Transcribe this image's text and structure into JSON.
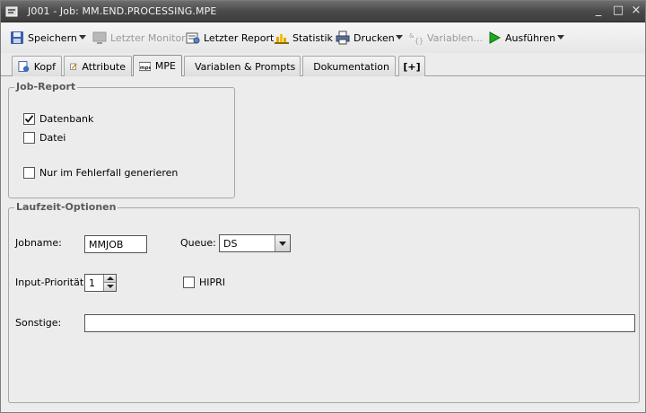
{
  "window": {
    "title": "J001 - Job: MM.END.PROCESSING.MPE",
    "minimize_symbol": "_",
    "maximize_symbol": "□",
    "close_symbol": "×"
  },
  "toolbar": {
    "save_label": "Speichern",
    "last_monitor_label": "Letzter Monitor",
    "last_report_label": "Letzter Report",
    "statistics_label": "Statistik",
    "print_label": "Drucken",
    "variables_label": "Variablen...",
    "execute_label": "Ausführen"
  },
  "tabs": [
    {
      "label": "Kopf",
      "icon": "header-icon"
    },
    {
      "label": "Attribute",
      "icon": "attributes-icon"
    },
    {
      "label": "MPE",
      "icon": "mpe-icon",
      "icon_text": "mpe",
      "active": true
    },
    {
      "label": "Variablen & Prompts",
      "icon": "variables-icon"
    },
    {
      "label": "Dokumentation",
      "icon": "documentation-icon"
    },
    {
      "label": "[+]",
      "icon": "add-tab-icon"
    }
  ],
  "job_report": {
    "title": "Job-Report",
    "database_label": "Datenbank",
    "database_checked": true,
    "file_label": "Datei",
    "file_checked": false,
    "on_error_label": "Nur im Fehlerfall generieren",
    "on_error_checked": false
  },
  "runtime": {
    "title": "Laufzeit-Optionen",
    "jobname_label": "Jobname:",
    "jobname_value": "MMJOB",
    "queue_label": "Queue:",
    "queue_value": "DS",
    "priority_label": "Input-Priorität:",
    "priority_value": "1",
    "hipri_label": "HIPRI",
    "hipri_checked": false,
    "other_label": "Sonstige:",
    "other_value": ""
  },
  "colors": {
    "titlebar": "#4a4a4a",
    "background": "#ececec",
    "execute_green": "#1fa81f"
  }
}
